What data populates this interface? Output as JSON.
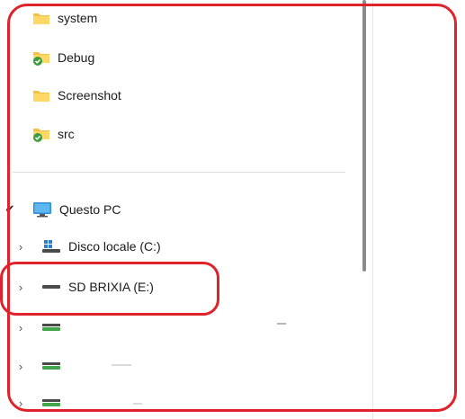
{
  "nav": {
    "folders": [
      {
        "label": "system",
        "icon": "folder-icon"
      },
      {
        "label": "Debug",
        "icon": "synced-folder-icon"
      },
      {
        "label": "Screenshot",
        "icon": "folder-icon"
      },
      {
        "label": "src",
        "icon": "synced-folder-icon"
      }
    ],
    "pc": {
      "label": "Questo PC",
      "icon": "monitor-icon",
      "expanded_mark": "✔"
    },
    "drives": [
      {
        "label": "Disco locale (C:)",
        "icon": "windows-drive-icon"
      },
      {
        "label": "SD BRIXIA (E:)",
        "icon": "removable-drive-icon"
      }
    ],
    "chevron": "›"
  },
  "colors": {
    "folder": "#f4c242",
    "sync_badge": "#3c9c3c",
    "annotation": "#e0222a",
    "drive_green": "#3fa64a"
  }
}
